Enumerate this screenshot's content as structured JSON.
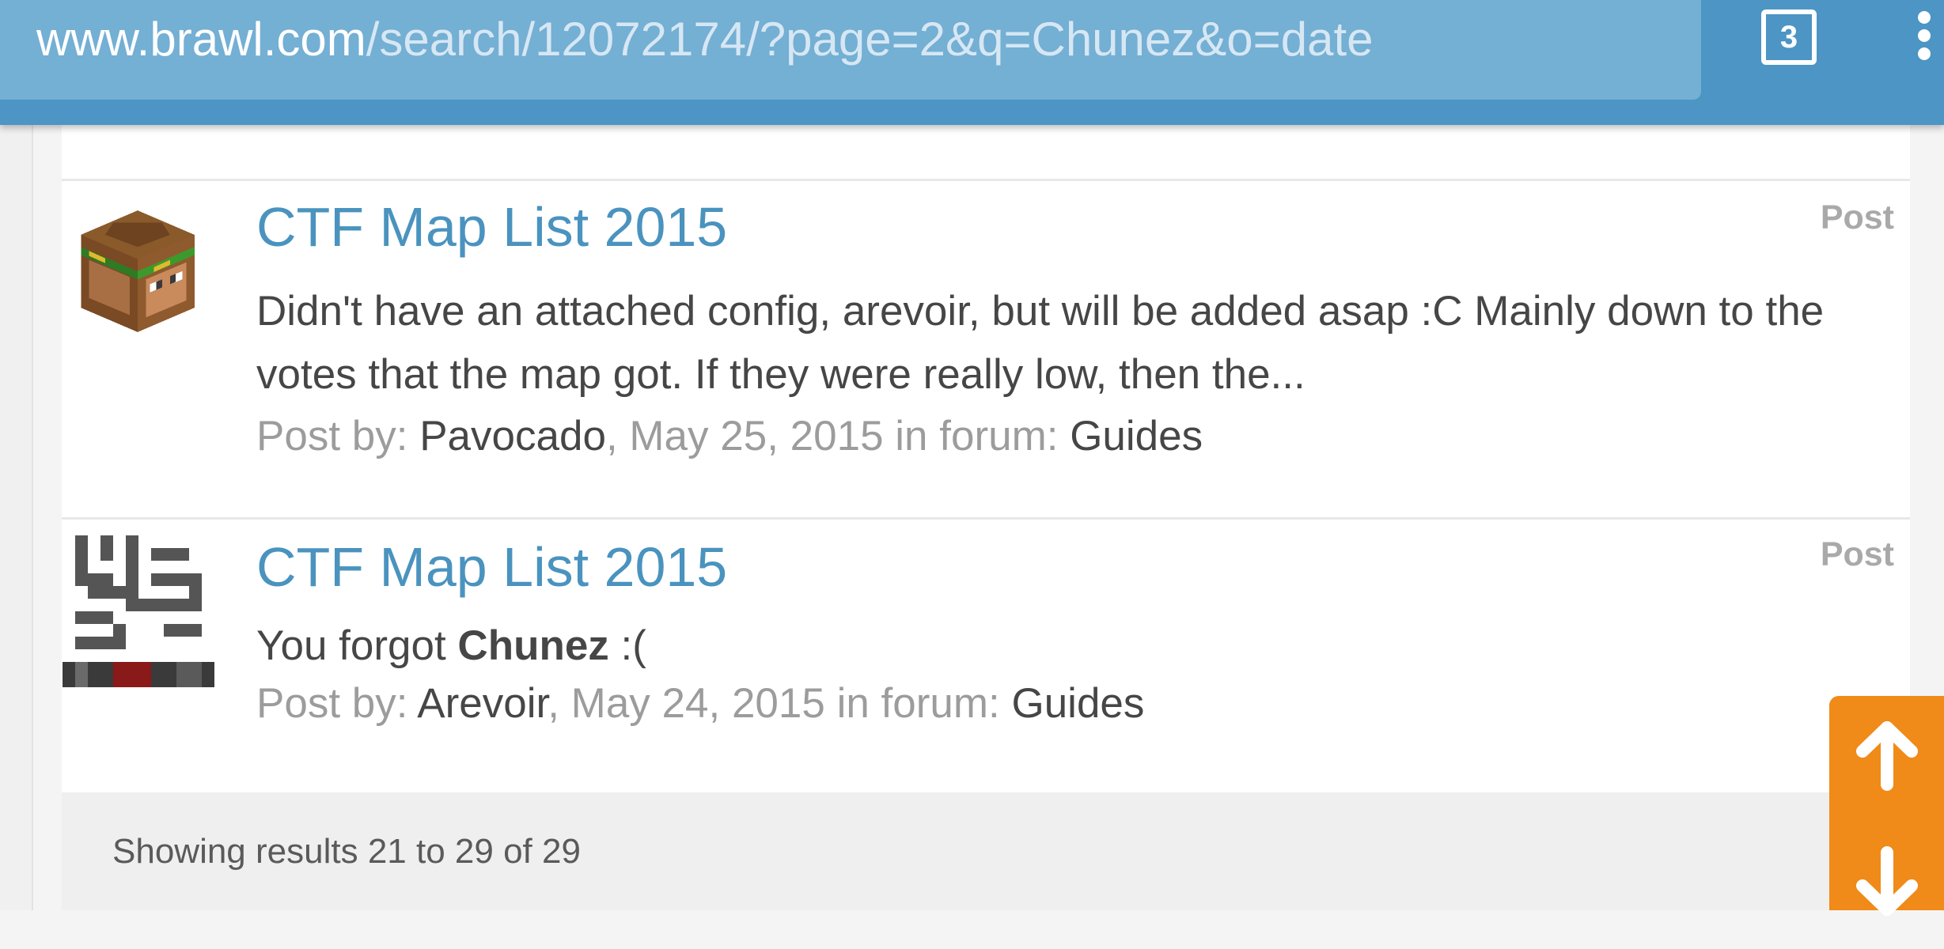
{
  "browser": {
    "url_domain": "www.brawl.com",
    "url_path": "/search/12072174/?page=2&q=Chunez&o=date",
    "tab_count": "3"
  },
  "results": [
    {
      "title": "CTF Map List 2015",
      "type": "Post",
      "snippet": "Didn't have an attached config, arevoir, but will be added asap :C Mainly down to the votes that the map got. If they were really low, then the...",
      "meta_prefix": "Post by: ",
      "author": "Pavocado",
      "date_text": ", May 25, 2015 in forum: ",
      "forum": "Guides"
    },
    {
      "title": "CTF Map List 2015",
      "type": "Post",
      "snippet_before": "You forgot ",
      "snippet_bold": "Chunez",
      "snippet_after": " :(",
      "meta_prefix": "Post by: ",
      "author": "Arevoir",
      "date_text": ", May 24, 2015 in forum: ",
      "forum": "Guides"
    }
  ],
  "footer": {
    "results_text": "Showing results 21 to 29 of 29"
  },
  "colors": {
    "toolbar": "#4c95c4",
    "link": "#4a93bf",
    "scroll_widget": "#f08a18"
  }
}
